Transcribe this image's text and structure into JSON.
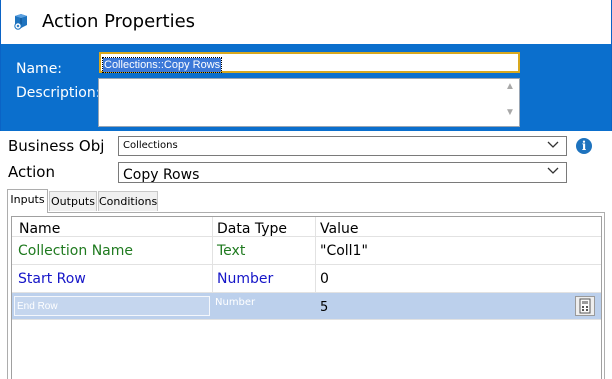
{
  "window": {
    "title": "Action Properties"
  },
  "header": {
    "name_label": "Name:",
    "name_value": "Collections::Copy Rows",
    "description_label": "Description:",
    "description_value": ""
  },
  "form": {
    "business_object_label": "Business Obj",
    "business_object_value": "Collections",
    "action_label": "Action",
    "action_value": "Copy Rows"
  },
  "tabs": [
    {
      "label": "Inputs",
      "active": true
    },
    {
      "label": "Outputs",
      "active": false
    },
    {
      "label": "Conditions",
      "active": false
    }
  ],
  "grid": {
    "columns": [
      "Name",
      "Data Type",
      "Value"
    ],
    "rows": [
      {
        "name": "Collection Name",
        "type": "Text",
        "value": "\"Coll1\"",
        "color": "#1f7a1f"
      },
      {
        "name": "Start Row",
        "type": "Number",
        "value": "0",
        "color": "#1515c8"
      },
      {
        "name": "End Row",
        "type": "Number",
        "value": "5",
        "selected": true
      }
    ]
  },
  "icons": {
    "app": "action-properties-icon",
    "info": "info-icon",
    "dropdown": "chevron-down-icon",
    "calculator": "calculator-icon"
  }
}
